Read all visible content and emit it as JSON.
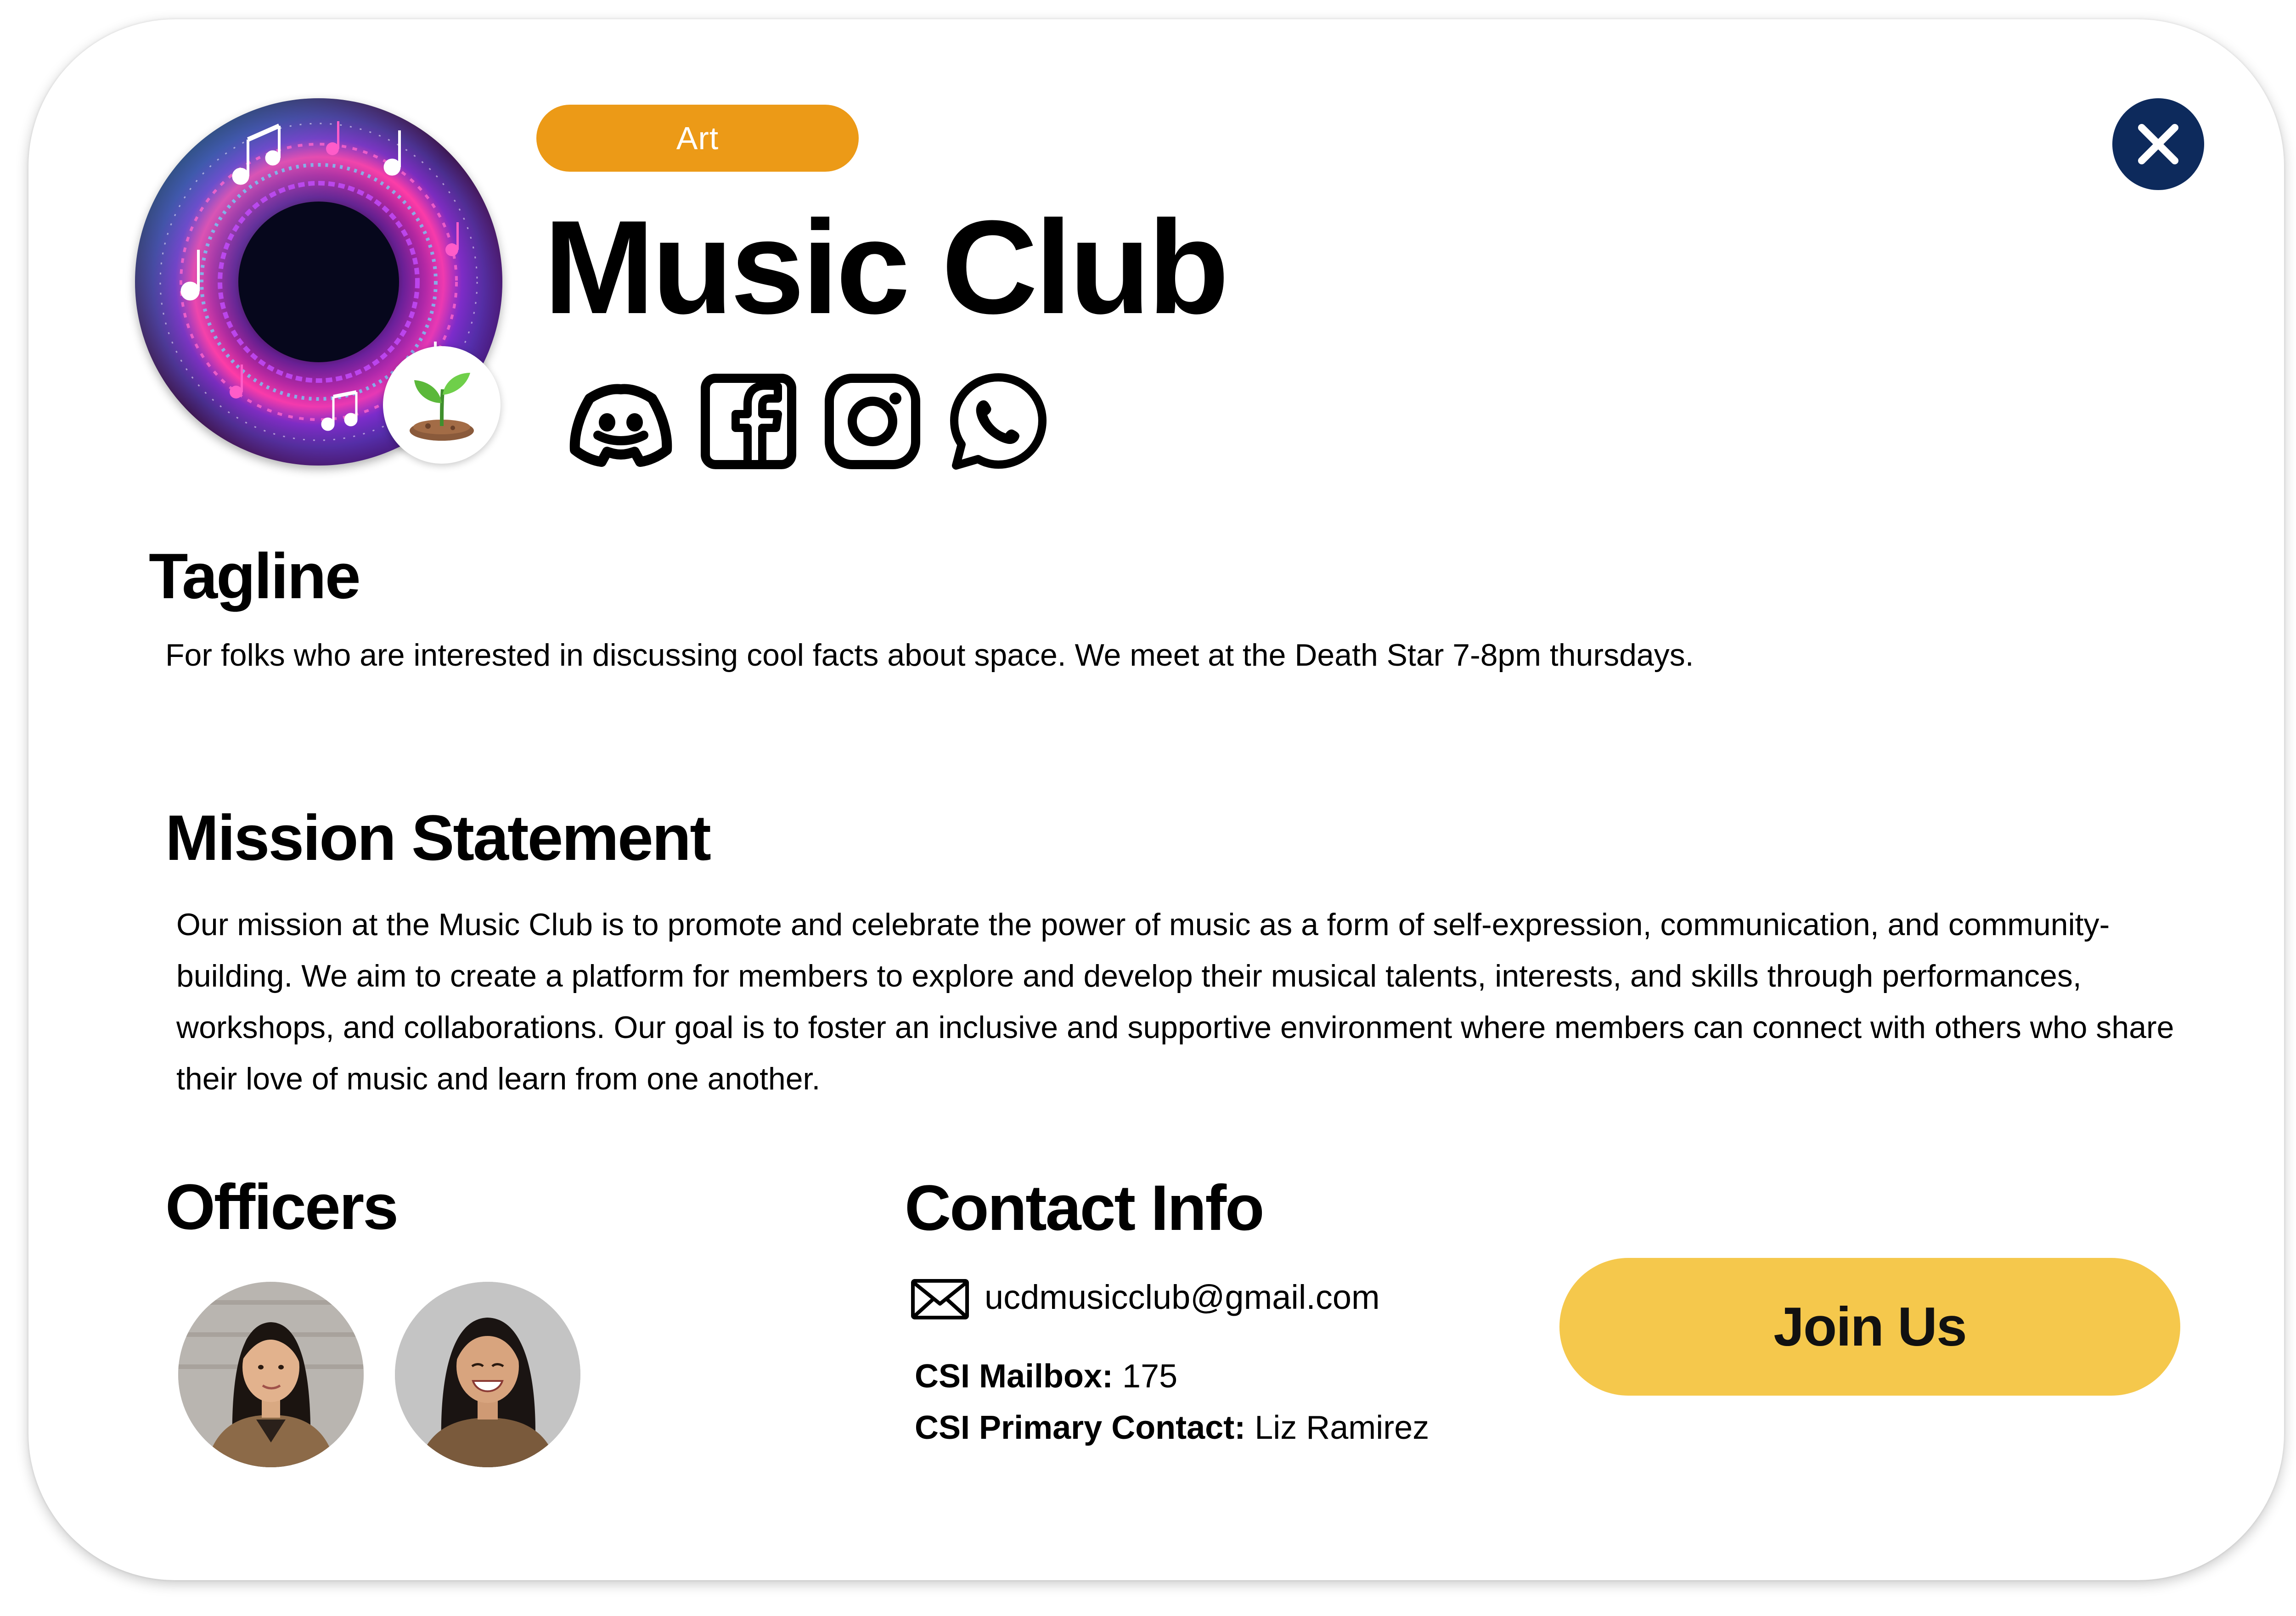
{
  "header": {
    "category": "Art",
    "club_name": "Music Club"
  },
  "icons": {
    "logo": "music-club-logo",
    "badge": "sprout-icon",
    "close": "close-icon",
    "socials": [
      "discord-icon",
      "facebook-icon",
      "instagram-icon",
      "whatsapp-icon"
    ],
    "mail": "mail-icon"
  },
  "tagline": {
    "title": "Tagline",
    "text": "For folks who are interested in discussing cool facts about space. We meet at the Death Star 7-8pm thursdays."
  },
  "mission": {
    "title": "Mission Statement",
    "text": "Our mission at the Music Club is to promote and celebrate the power of music as a form of self-expression, communication, and community-building. We aim to create a platform for members to explore and develop their musical talents, interests, and skills through performances, workshops, and collaborations. Our goal is to foster an inclusive and supportive environment where members can connect with others who share their love of music and learn from one another."
  },
  "officers": {
    "title": "Officers"
  },
  "contact": {
    "title": "Contact Info",
    "email": "ucdmusicclub@gmail.com",
    "mailbox_label": "CSI Mailbox:",
    "mailbox_value": " 175",
    "primary_label": "CSI Primary Contact:",
    "primary_value": " Liz Ramirez"
  },
  "actions": {
    "join_label": "Join Us"
  },
  "colors": {
    "category_pill": "#ec9a17",
    "join_button": "#f5c84c",
    "close_button": "#0d2a5c"
  }
}
